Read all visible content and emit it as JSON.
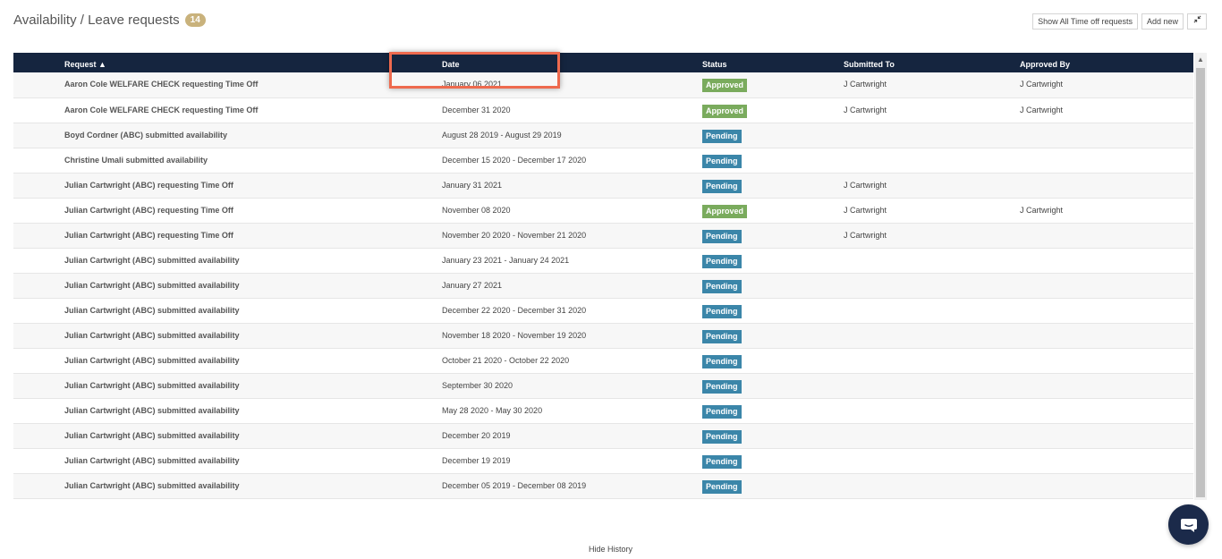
{
  "header": {
    "title": "Availability / Leave requests",
    "count": "14"
  },
  "actions": {
    "show_all_label": "Show All Time off requests",
    "add_new_label": "Add new",
    "collapse_icon": "collapse-icon"
  },
  "table": {
    "columns": [
      "Request ▲",
      "Date",
      "Status",
      "Submitted To",
      "Approved By"
    ],
    "rows": [
      {
        "request": "Aaron Cole WELFARE CHECK requesting Time Off",
        "date": "January 06 2021",
        "status": "Approved",
        "submitted_to": "J Cartwright",
        "approved_by": "J Cartwright"
      },
      {
        "request": "Aaron Cole WELFARE CHECK requesting Time Off",
        "date": "December 31 2020",
        "status": "Approved",
        "submitted_to": "J Cartwright",
        "approved_by": "J Cartwright"
      },
      {
        "request": "Boyd Cordner (ABC) submitted availability",
        "date": "August 28 2019 - August 29 2019",
        "status": "Pending",
        "submitted_to": "",
        "approved_by": ""
      },
      {
        "request": "Christine Umali submitted availability",
        "date": "December 15 2020 - December 17 2020",
        "status": "Pending",
        "submitted_to": "",
        "approved_by": ""
      },
      {
        "request": "Julian Cartwright (ABC) requesting Time Off",
        "date": "January 31 2021",
        "status": "Pending",
        "submitted_to": "J Cartwright",
        "approved_by": ""
      },
      {
        "request": "Julian Cartwright (ABC) requesting Time Off",
        "date": "November 08 2020",
        "status": "Approved",
        "submitted_to": "J Cartwright",
        "approved_by": "J Cartwright"
      },
      {
        "request": "Julian Cartwright (ABC) requesting Time Off",
        "date": "November 20 2020 - November 21 2020",
        "status": "Pending",
        "submitted_to": "J Cartwright",
        "approved_by": ""
      },
      {
        "request": "Julian Cartwright (ABC) submitted availability",
        "date": "January 23 2021 - January 24 2021",
        "status": "Pending",
        "submitted_to": "",
        "approved_by": ""
      },
      {
        "request": "Julian Cartwright (ABC) submitted availability",
        "date": "January 27 2021",
        "status": "Pending",
        "submitted_to": "",
        "approved_by": ""
      },
      {
        "request": "Julian Cartwright (ABC) submitted availability",
        "date": "December 22 2020 - December 31 2020",
        "status": "Pending",
        "submitted_to": "",
        "approved_by": ""
      },
      {
        "request": "Julian Cartwright (ABC) submitted availability",
        "date": "November 18 2020 - November 19 2020",
        "status": "Pending",
        "submitted_to": "",
        "approved_by": ""
      },
      {
        "request": "Julian Cartwright (ABC) submitted availability",
        "date": "October 21 2020 - October 22 2020",
        "status": "Pending",
        "submitted_to": "",
        "approved_by": ""
      },
      {
        "request": "Julian Cartwright (ABC) submitted availability",
        "date": "September 30 2020",
        "status": "Pending",
        "submitted_to": "",
        "approved_by": ""
      },
      {
        "request": "Julian Cartwright (ABC) submitted availability",
        "date": "May 28 2020 - May 30 2020",
        "status": "Pending",
        "submitted_to": "",
        "approved_by": ""
      },
      {
        "request": "Julian Cartwright (ABC) submitted availability",
        "date": "December 20 2019",
        "status": "Pending",
        "submitted_to": "",
        "approved_by": ""
      },
      {
        "request": "Julian Cartwright (ABC) submitted availability",
        "date": "December 19 2019",
        "status": "Pending",
        "submitted_to": "",
        "approved_by": ""
      },
      {
        "request": "Julian Cartwright (ABC) submitted availability",
        "date": "December 05 2019 - December 08 2019",
        "status": "Pending",
        "submitted_to": "",
        "approved_by": ""
      }
    ]
  },
  "footer": {
    "hide_history_label": "Hide History"
  },
  "chat": {
    "icon": "chat-bubble-icon"
  },
  "colors": {
    "header_bg": "#15253f",
    "approved": "#7aab5d",
    "pending": "#3b86a9",
    "badge": "#c9b27c",
    "highlight": "#ee6a4e"
  }
}
